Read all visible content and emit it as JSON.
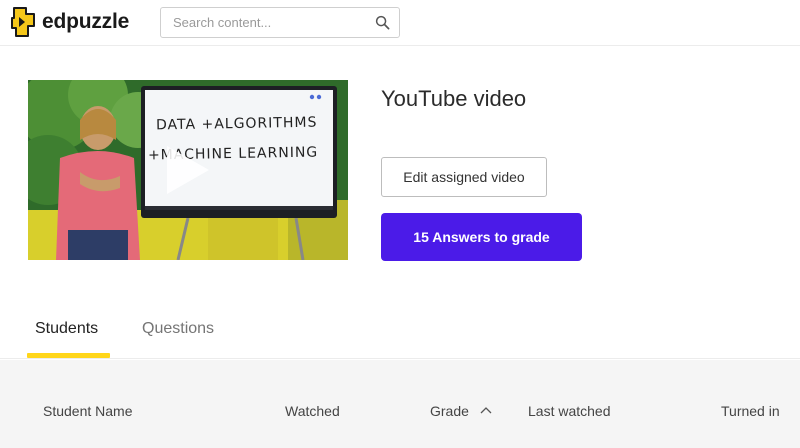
{
  "header": {
    "logo_text": "edpuzzle",
    "search": {
      "placeholder": "Search content..."
    }
  },
  "video": {
    "title": "YouTube video",
    "whiteboard_line1": "DATA +ALGORITHMS",
    "whiteboard_line2": "+MACHINE LEARNING",
    "edit_button_label": "Edit assigned video",
    "grade_button_label": "15 Answers to grade"
  },
  "tabs": [
    {
      "label": "Students",
      "active": true
    },
    {
      "label": "Questions",
      "active": false
    }
  ],
  "table": {
    "columns": [
      "Student Name",
      "Watched",
      "Grade",
      "Last watched",
      "Turned in"
    ],
    "sorted_column": "Grade",
    "sort_direction": "ascending"
  },
  "colors": {
    "brand_yellow": "#ffd61a",
    "primary_purple": "#4b1be8",
    "logo_icon": "#f5c71a"
  },
  "icons": [
    "edpuzzle-logo-icon",
    "search-icon",
    "play-icon",
    "sort-ascending-icon"
  ]
}
